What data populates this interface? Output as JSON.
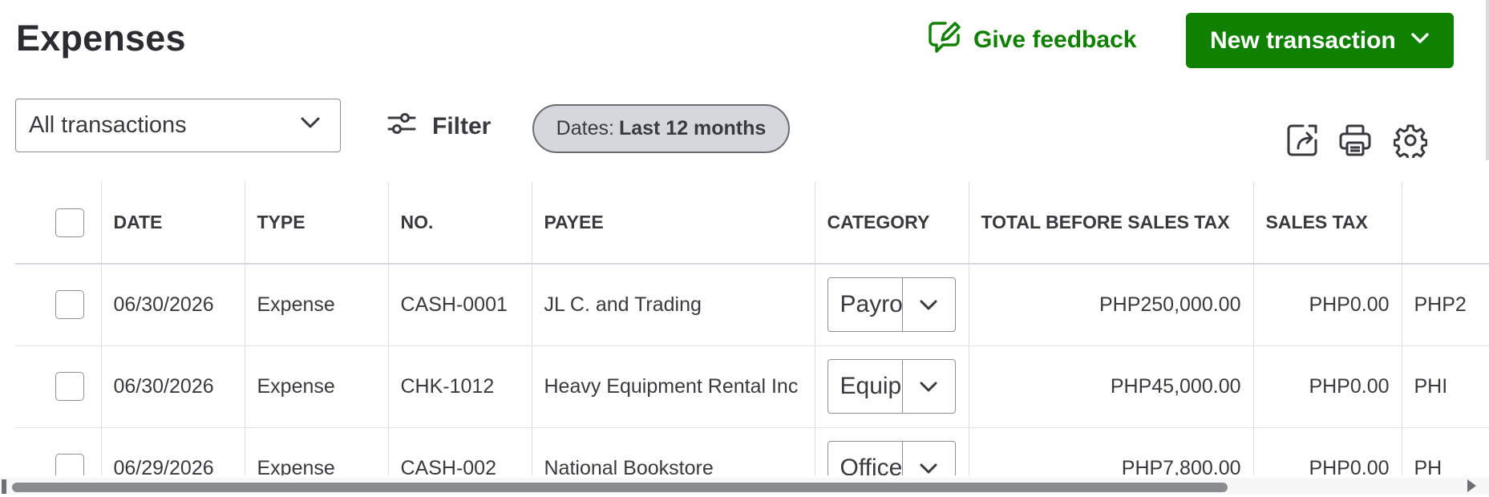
{
  "page": {
    "title": "Expenses"
  },
  "header": {
    "feedback_label": "Give feedback",
    "new_transaction_label": "New transaction"
  },
  "filters": {
    "transaction_type": "All transactions",
    "filter_label": "Filter",
    "dates_prefix": "Dates:",
    "dates_value": "Last 12 months"
  },
  "toolbar_icons": [
    "export-icon",
    "print-icon",
    "settings-gear-icon"
  ],
  "table": {
    "columns": [
      "DATE",
      "TYPE",
      "NO.",
      "PAYEE",
      "CATEGORY",
      "TOTAL BEFORE SALES TAX",
      "SALES TAX",
      ""
    ],
    "rows": [
      {
        "date": "06/30/2026",
        "type": "Expense",
        "no": "CASH-0001",
        "payee": "JL C. and Trading",
        "category": "Payro",
        "total_before_tax": "PHP250,000.00",
        "sales_tax": "PHP0.00",
        "total": "PHP2"
      },
      {
        "date": "06/30/2026",
        "type": "Expense",
        "no": "CHK-1012",
        "payee": "Heavy Equipment Rental Inc",
        "category": "Equip",
        "total_before_tax": "PHP45,000.00",
        "sales_tax": "PHP0.00",
        "total": "PHI"
      },
      {
        "date": "06/29/2026",
        "type": "Expense",
        "no": "CASH-002",
        "payee": "National Bookstore",
        "category": "Office",
        "total_before_tax": "PHP7,800.00",
        "sales_tax": "PHP0.00",
        "total": "PH"
      }
    ]
  },
  "colors": {
    "brand_green": "#108000",
    "chip_bg": "#d4d7dc",
    "text": "#393a3d"
  }
}
